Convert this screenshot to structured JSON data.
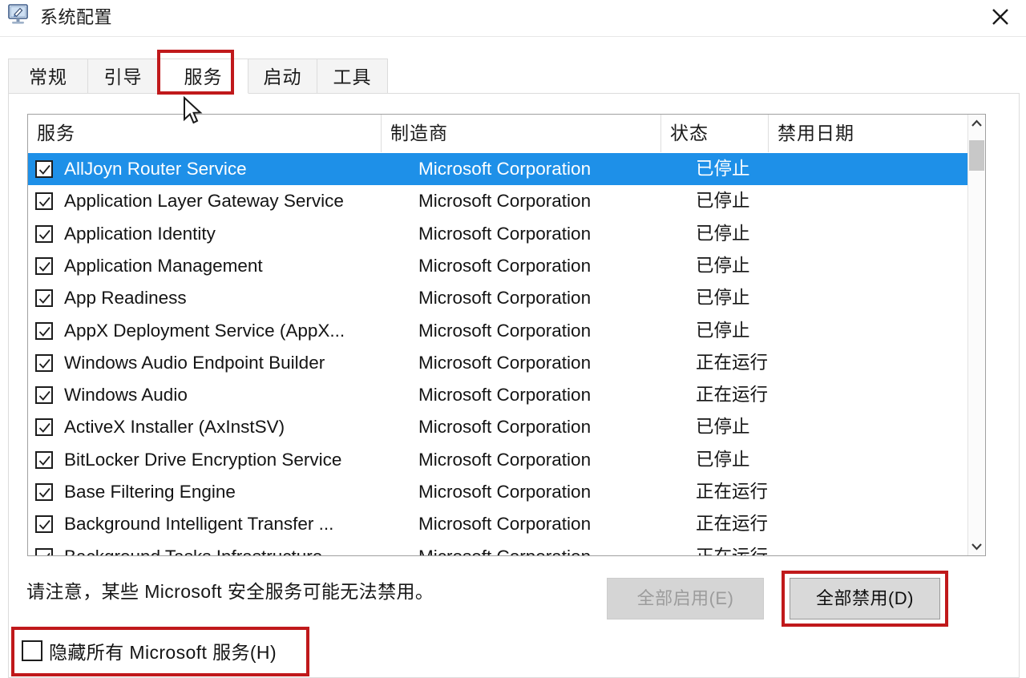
{
  "window": {
    "title": "系统配置",
    "icon": "system-config-monitor-icon",
    "close_label": "✕"
  },
  "tabs": [
    {
      "label": "常规",
      "active": false,
      "highlighted": false
    },
    {
      "label": "引导",
      "active": false,
      "highlighted": false
    },
    {
      "label": "服务",
      "active": true,
      "highlighted": true
    },
    {
      "label": "启动",
      "active": false,
      "highlighted": false
    },
    {
      "label": "工具",
      "active": false,
      "highlighted": false
    }
  ],
  "list": {
    "columns": [
      {
        "label": "服务"
      },
      {
        "label": "制造商"
      },
      {
        "label": "状态"
      },
      {
        "label": "禁用日期"
      }
    ],
    "rows": [
      {
        "checked": true,
        "selected": true,
        "name": "AllJoyn Router Service",
        "manufacturer": "Microsoft Corporation",
        "status": "已停止",
        "disabled_date": ""
      },
      {
        "checked": true,
        "selected": false,
        "name": "Application Layer Gateway Service",
        "manufacturer": "Microsoft Corporation",
        "status": "已停止",
        "disabled_date": ""
      },
      {
        "checked": true,
        "selected": false,
        "name": "Application Identity",
        "manufacturer": "Microsoft Corporation",
        "status": "已停止",
        "disabled_date": ""
      },
      {
        "checked": true,
        "selected": false,
        "name": "Application Management",
        "manufacturer": "Microsoft Corporation",
        "status": "已停止",
        "disabled_date": ""
      },
      {
        "checked": true,
        "selected": false,
        "name": "App Readiness",
        "manufacturer": "Microsoft Corporation",
        "status": "已停止",
        "disabled_date": ""
      },
      {
        "checked": true,
        "selected": false,
        "name": "AppX Deployment Service (AppX...",
        "manufacturer": "Microsoft Corporation",
        "status": "已停止",
        "disabled_date": ""
      },
      {
        "checked": true,
        "selected": false,
        "name": "Windows Audio Endpoint Builder",
        "manufacturer": "Microsoft Corporation",
        "status": "正在运行",
        "disabled_date": ""
      },
      {
        "checked": true,
        "selected": false,
        "name": "Windows Audio",
        "manufacturer": "Microsoft Corporation",
        "status": "正在运行",
        "disabled_date": ""
      },
      {
        "checked": true,
        "selected": false,
        "name": "ActiveX Installer (AxInstSV)",
        "manufacturer": "Microsoft Corporation",
        "status": "已停止",
        "disabled_date": ""
      },
      {
        "checked": true,
        "selected": false,
        "name": "BitLocker Drive Encryption Service",
        "manufacturer": "Microsoft Corporation",
        "status": "已停止",
        "disabled_date": ""
      },
      {
        "checked": true,
        "selected": false,
        "name": "Base Filtering Engine",
        "manufacturer": "Microsoft Corporation",
        "status": "正在运行",
        "disabled_date": ""
      },
      {
        "checked": true,
        "selected": false,
        "name": "Background Intelligent Transfer ...",
        "manufacturer": "Microsoft Corporation",
        "status": "正在运行",
        "disabled_date": ""
      },
      {
        "checked": true,
        "selected": false,
        "name": "Background Tasks Infrastructure",
        "manufacturer": "Microsoft Corporation",
        "status": "正在运行",
        "disabled_date": ""
      }
    ]
  },
  "footer": {
    "note": "请注意，某些 Microsoft 安全服务可能无法禁用。",
    "enable_all_label": "全部启用(E)",
    "disable_all_label": "全部禁用(D)",
    "hide_microsoft_label": "隐藏所有 Microsoft 服务(H)",
    "hide_microsoft_checked": false
  },
  "colors": {
    "selection_blue": "#1e90e8",
    "highlight_red": "#c0191b",
    "disabled_text": "#9c9c9c"
  }
}
